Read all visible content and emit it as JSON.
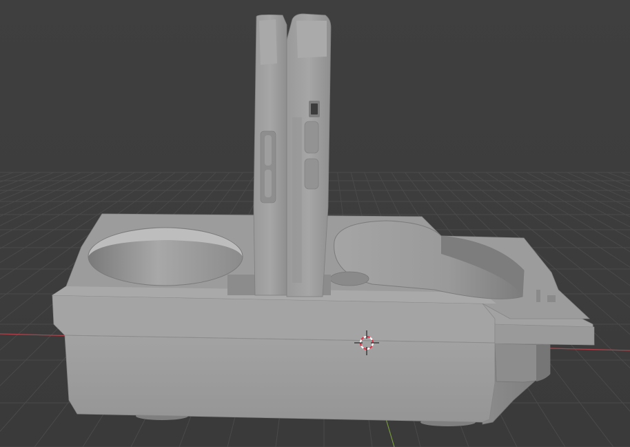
{
  "viewport": {
    "kind": "blender-3d-viewport",
    "background_color": "#3d3d3d",
    "grid_color": "#4a4a4a",
    "x_axis_color": "#b0434b",
    "y_axis_color": "#7ca23c"
  },
  "scene": {
    "object": "cup-holder-with-phone-slots",
    "model_color": "#9e9e9e",
    "icons": {
      "cursor": "3d-cursor-icon"
    }
  }
}
